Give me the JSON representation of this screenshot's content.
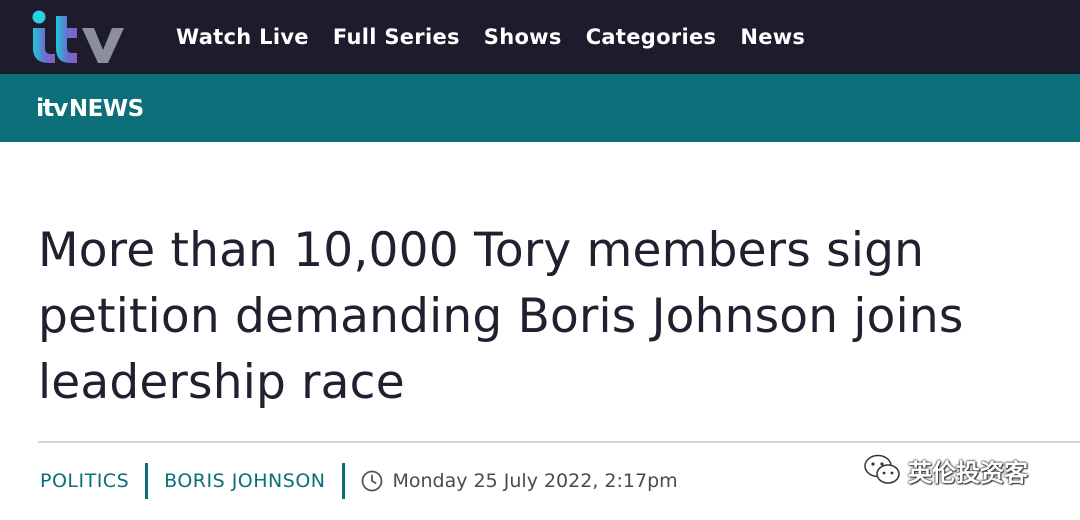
{
  "header": {
    "logo_text": "itv",
    "nav": [
      "Watch Live",
      "Full Series",
      "Shows",
      "Categories",
      "News"
    ]
  },
  "subheader": {
    "logo_itv": "itv",
    "logo_news": "NEWS"
  },
  "article": {
    "headline_lines": [
      "More than 10,000 Tory members sign",
      "petition demanding Boris Johnson joins",
      "leadership race"
    ],
    "tags": [
      "POLITICS",
      "BORIS JOHNSON"
    ],
    "timestamp": "Monday 25 July 2022, 2:17pm"
  },
  "watermark": {
    "text": "英伦投资客",
    "icon": "wechat-icon"
  },
  "colors": {
    "topbar": "#1d1b2c",
    "news_teal": "#0b6e79",
    "logo_gradient": [
      "#22c3d6",
      "#7b5fc7",
      "#f0a73a"
    ]
  }
}
